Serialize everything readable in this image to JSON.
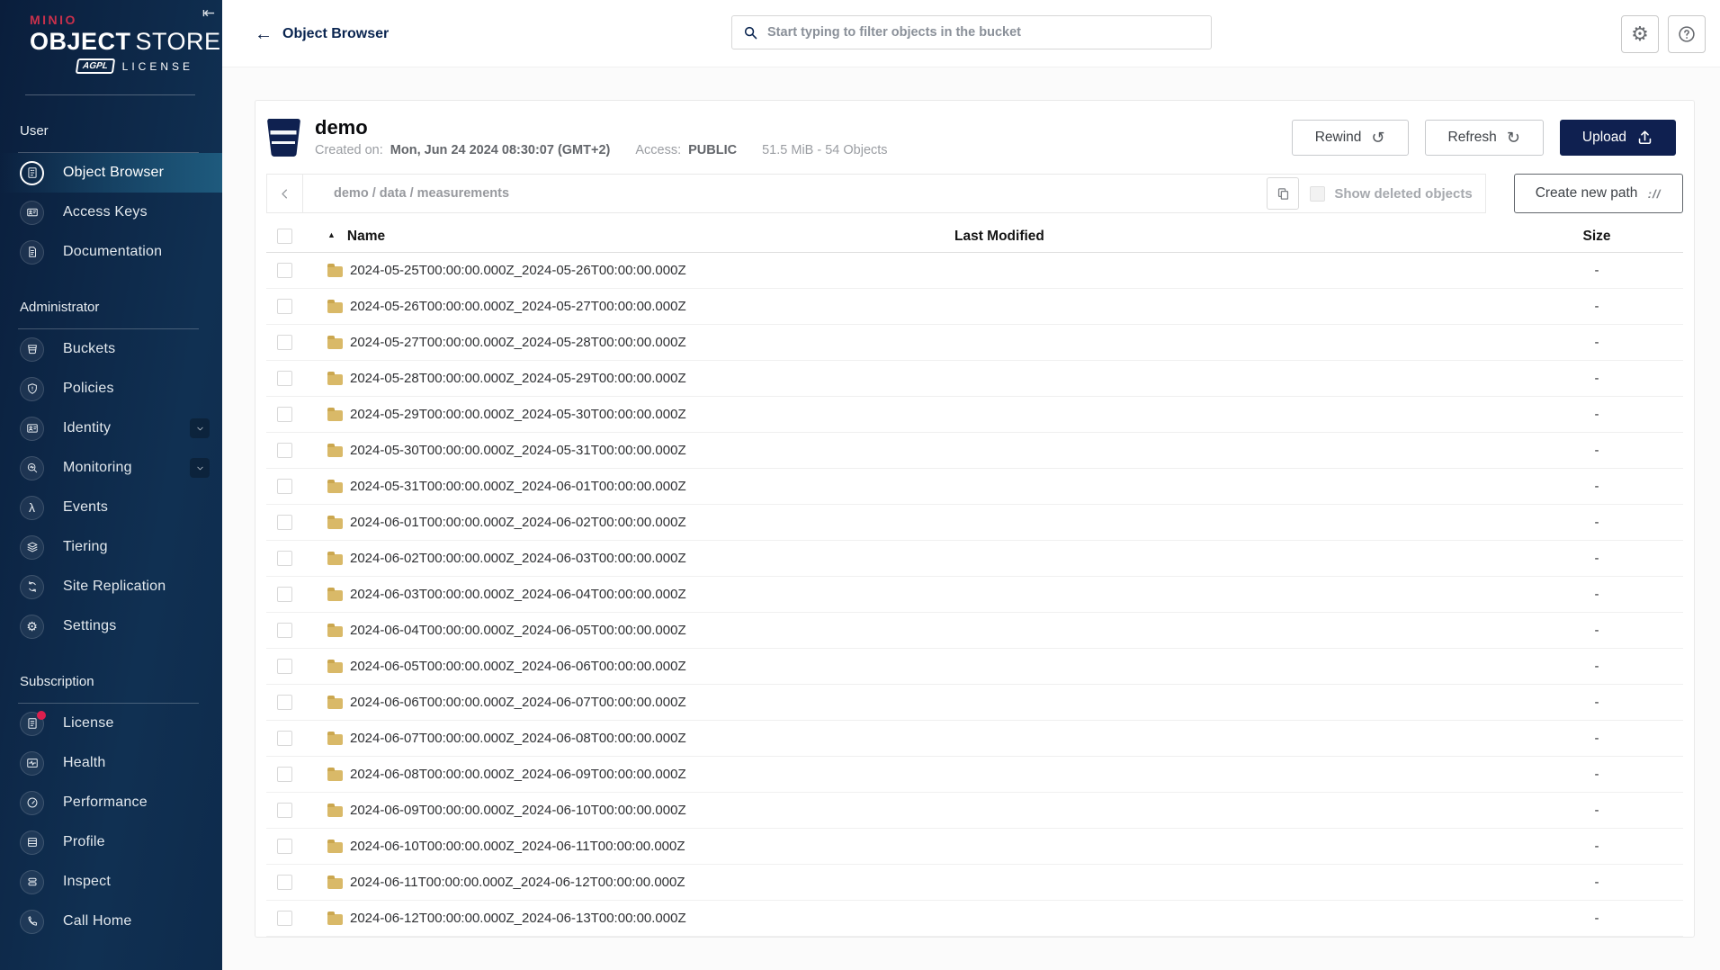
{
  "sidebar": {
    "logo": {
      "brand": "MINIO",
      "title_bold": "OBJECT",
      "title_light": "STORE",
      "badge": "AGPL",
      "license": "LICENSE"
    },
    "collapse_glyph": "⇤",
    "sections": [
      {
        "label": "User",
        "items": [
          {
            "label": "Object Browser",
            "icon": "object-browser",
            "selected": true
          },
          {
            "label": "Access Keys",
            "icon": "access-keys"
          },
          {
            "label": "Documentation",
            "icon": "documentation"
          }
        ]
      },
      {
        "label": "Administrator",
        "items": [
          {
            "label": "Buckets",
            "icon": "buckets"
          },
          {
            "label": "Policies",
            "icon": "policies"
          },
          {
            "label": "Identity",
            "icon": "identity",
            "chevron": true
          },
          {
            "label": "Monitoring",
            "icon": "monitoring",
            "chevron": true
          },
          {
            "label": "Events",
            "icon": "events"
          },
          {
            "label": "Tiering",
            "icon": "tiering"
          },
          {
            "label": "Site Replication",
            "icon": "site-replication"
          },
          {
            "label": "Settings",
            "icon": "settings"
          }
        ]
      },
      {
        "label": "Subscription",
        "items": [
          {
            "label": "License",
            "icon": "license",
            "badge_dot": true
          },
          {
            "label": "Health",
            "icon": "health"
          },
          {
            "label": "Performance",
            "icon": "performance"
          },
          {
            "label": "Profile",
            "icon": "profile"
          },
          {
            "label": "Inspect",
            "icon": "inspect"
          },
          {
            "label": "Call Home",
            "icon": "call-home"
          }
        ]
      }
    ]
  },
  "topbar": {
    "title": "Object Browser",
    "back_glyph": "←",
    "search_placeholder": "Start typing to filter objects in the bucket"
  },
  "bucket": {
    "name": "demo",
    "created_label": "Created on:",
    "created_value": "Mon, Jun 24 2024 08:30:07 (GMT+2)",
    "access_label": "Access:",
    "access_value": "PUBLIC",
    "usage": "51.5 MiB - 54 Objects",
    "actions": {
      "rewind": "Rewind",
      "rewind_glyph": "↺",
      "refresh": "Refresh",
      "refresh_glyph": "↻",
      "upload": "Upload"
    }
  },
  "browser": {
    "breadcrumb": "demo / data / measurements",
    "show_deleted_label": "Show deleted objects",
    "create_path_label": "Create new path",
    "create_path_glyph": "://"
  },
  "table": {
    "columns": {
      "name": "Name",
      "last_modified": "Last Modified",
      "size": "Size"
    },
    "sort_caret": "▲",
    "rows": [
      {
        "name": "2024-05-25T00:00:00.000Z_2024-05-26T00:00:00.000Z",
        "last_modified": "",
        "size": "-"
      },
      {
        "name": "2024-05-26T00:00:00.000Z_2024-05-27T00:00:00.000Z",
        "last_modified": "",
        "size": "-"
      },
      {
        "name": "2024-05-27T00:00:00.000Z_2024-05-28T00:00:00.000Z",
        "last_modified": "",
        "size": "-"
      },
      {
        "name": "2024-05-28T00:00:00.000Z_2024-05-29T00:00:00.000Z",
        "last_modified": "",
        "size": "-"
      },
      {
        "name": "2024-05-29T00:00:00.000Z_2024-05-30T00:00:00.000Z",
        "last_modified": "",
        "size": "-"
      },
      {
        "name": "2024-05-30T00:00:00.000Z_2024-05-31T00:00:00.000Z",
        "last_modified": "",
        "size": "-"
      },
      {
        "name": "2024-05-31T00:00:00.000Z_2024-06-01T00:00:00.000Z",
        "last_modified": "",
        "size": "-"
      },
      {
        "name": "2024-06-01T00:00:00.000Z_2024-06-02T00:00:00.000Z",
        "last_modified": "",
        "size": "-"
      },
      {
        "name": "2024-06-02T00:00:00.000Z_2024-06-03T00:00:00.000Z",
        "last_modified": "",
        "size": "-"
      },
      {
        "name": "2024-06-03T00:00:00.000Z_2024-06-04T00:00:00.000Z",
        "last_modified": "",
        "size": "-"
      },
      {
        "name": "2024-06-04T00:00:00.000Z_2024-06-05T00:00:00.000Z",
        "last_modified": "",
        "size": "-"
      },
      {
        "name": "2024-06-05T00:00:00.000Z_2024-06-06T00:00:00.000Z",
        "last_modified": "",
        "size": "-"
      },
      {
        "name": "2024-06-06T00:00:00.000Z_2024-06-07T00:00:00.000Z",
        "last_modified": "",
        "size": "-"
      },
      {
        "name": "2024-06-07T00:00:00.000Z_2024-06-08T00:00:00.000Z",
        "last_modified": "",
        "size": "-"
      },
      {
        "name": "2024-06-08T00:00:00.000Z_2024-06-09T00:00:00.000Z",
        "last_modified": "",
        "size": "-"
      },
      {
        "name": "2024-06-09T00:00:00.000Z_2024-06-10T00:00:00.000Z",
        "last_modified": "",
        "size": "-"
      },
      {
        "name": "2024-06-10T00:00:00.000Z_2024-06-11T00:00:00.000Z",
        "last_modified": "",
        "size": "-"
      },
      {
        "name": "2024-06-11T00:00:00.000Z_2024-06-12T00:00:00.000Z",
        "last_modified": "",
        "size": "-"
      },
      {
        "name": "2024-06-12T00:00:00.000Z_2024-06-13T00:00:00.000Z",
        "last_modified": "",
        "size": "-"
      }
    ]
  },
  "colors": {
    "brand_red": "#C9304C",
    "navy": "#0F2050",
    "selected_gradient_end": "#1E5A7D",
    "folder": "#D9B968",
    "badge_dot": "#DC1F4E"
  }
}
